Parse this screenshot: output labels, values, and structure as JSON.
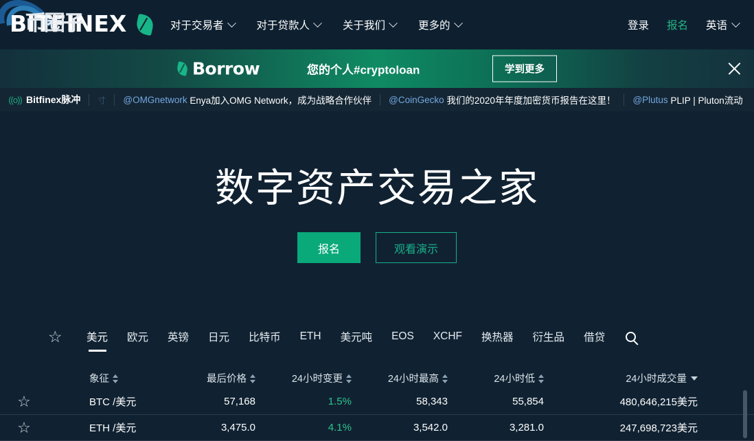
{
  "header": {
    "logo_text": "BITFINEX",
    "logo_overlay_cn": "币圈子",
    "nav": [
      {
        "label": "对于交易者",
        "has_caret": true
      },
      {
        "label": "对于贷款人",
        "has_caret": true
      },
      {
        "label": "关于我们",
        "has_caret": true
      },
      {
        "label": "更多的",
        "has_caret": true
      }
    ],
    "login_label": "登录",
    "signup_label": "报名",
    "language_label": "英语",
    "accent_green": "#22b585"
  },
  "promo": {
    "brand": "Borrow",
    "tagline": "您的个人#cryptoloan",
    "cta_label": "学到更多",
    "close_icon": "close-icon",
    "gradient_start": "#13303c",
    "gradient_mid": "#0f8b63",
    "gradient_end": "#14323d"
  },
  "ticker": {
    "pulse_label": "Bitfinex脉冲",
    "pulse_icon": "broadcast-icon",
    "tiny_mark": "寸",
    "items": [
      {
        "handle": "@OMGnetwork",
        "text": "Enya加入OMG Network，成为战略合作伙伴"
      },
      {
        "handle": "@CoinGecko",
        "text": "我们的2020年年度加密货币报告在这里！"
      },
      {
        "handle": "@Plutus",
        "text": "PLIP | Pluton流动"
      }
    ]
  },
  "hero": {
    "title": "数字资产交易之家",
    "primary_button": "报名",
    "secondary_button": "观看演示"
  },
  "tabs": {
    "star_icon": "star-icon",
    "search_icon": "search-icon",
    "items": [
      {
        "label": "美元",
        "active": true
      },
      {
        "label": "欧元",
        "active": false
      },
      {
        "label": "英镑",
        "active": false
      },
      {
        "label": "日元",
        "active": false
      },
      {
        "label": "比特币",
        "active": false
      },
      {
        "label": "ETH",
        "active": false
      },
      {
        "label": "美元吨",
        "active": false
      },
      {
        "label": "EOS",
        "active": false
      },
      {
        "label": "XCHF",
        "active": false
      },
      {
        "label": "换热器",
        "active": false
      },
      {
        "label": "衍生品",
        "active": false
      },
      {
        "label": "借贷",
        "active": false
      }
    ]
  },
  "table": {
    "columns": [
      {
        "label": "象征",
        "sort": "both"
      },
      {
        "label": "最后价格",
        "sort": "both"
      },
      {
        "label": "24小时变更",
        "sort": "both"
      },
      {
        "label": "24小时最高",
        "sort": "both"
      },
      {
        "label": "24小时低",
        "sort": "both"
      },
      {
        "label": "24小时成交量",
        "sort": "desc"
      }
    ],
    "rows": [
      {
        "symbol": "BTC /美元",
        "last_price": "57,168",
        "change_24h": "1.5%",
        "high_24h": "58,343",
        "low_24h": "55,854",
        "volume_24h": "480,646,215美元",
        "favorite": false
      },
      {
        "symbol": "ETH /美元",
        "last_price": "3,475.0",
        "change_24h": "4.1%",
        "high_24h": "3,542.0",
        "low_24h": "3,281.0",
        "volume_24h": "247,698,723美元",
        "favorite": false
      }
    ],
    "change_positive_color": "#2ec48e"
  }
}
